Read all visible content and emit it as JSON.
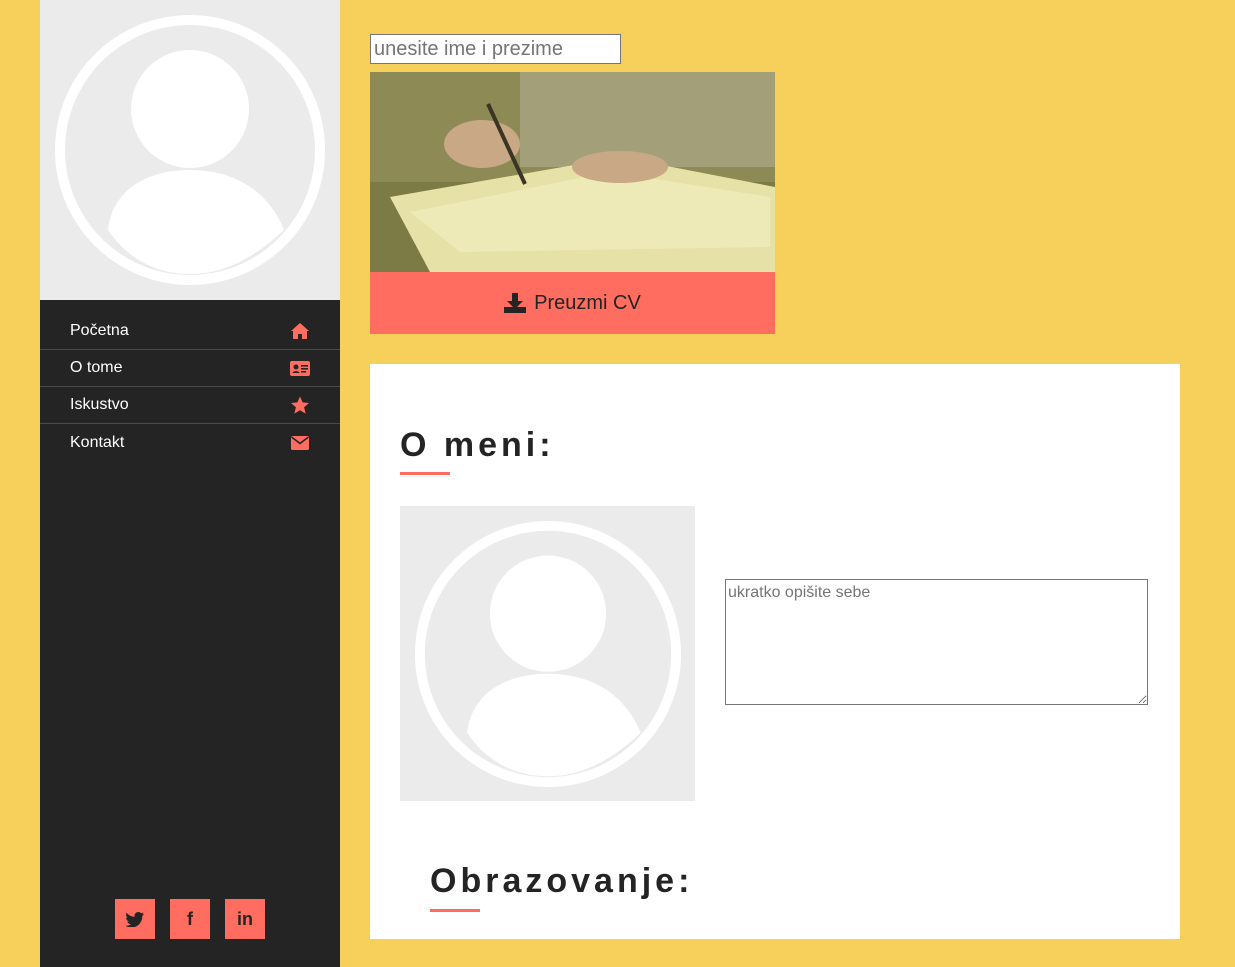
{
  "sidebar": {
    "nav": [
      {
        "label": "Početna",
        "icon": "home-icon"
      },
      {
        "label": "O tome",
        "icon": "id-card-icon"
      },
      {
        "label": "Iskustvo",
        "icon": "star-icon"
      },
      {
        "label": "Kontakt",
        "icon": "envelope-icon"
      }
    ],
    "social": [
      {
        "label": "🐦",
        "icon": "twitter-icon"
      },
      {
        "label": "f",
        "icon": "facebook-icon"
      },
      {
        "label": "in",
        "icon": "linkedin-icon"
      }
    ]
  },
  "main": {
    "name_placeholder": "unesite ime i prezime",
    "download_label": "Preuzmi CV",
    "about_title": "O meni:",
    "about_placeholder": "ukratko opišite sebe",
    "education_title": "Obrazovanje:"
  },
  "colors": {
    "background": "#f6d05a",
    "sidebar": "#242424",
    "accent": "#ff6d61",
    "card": "#ffffff",
    "avatar_bg": "#ebebeb"
  }
}
